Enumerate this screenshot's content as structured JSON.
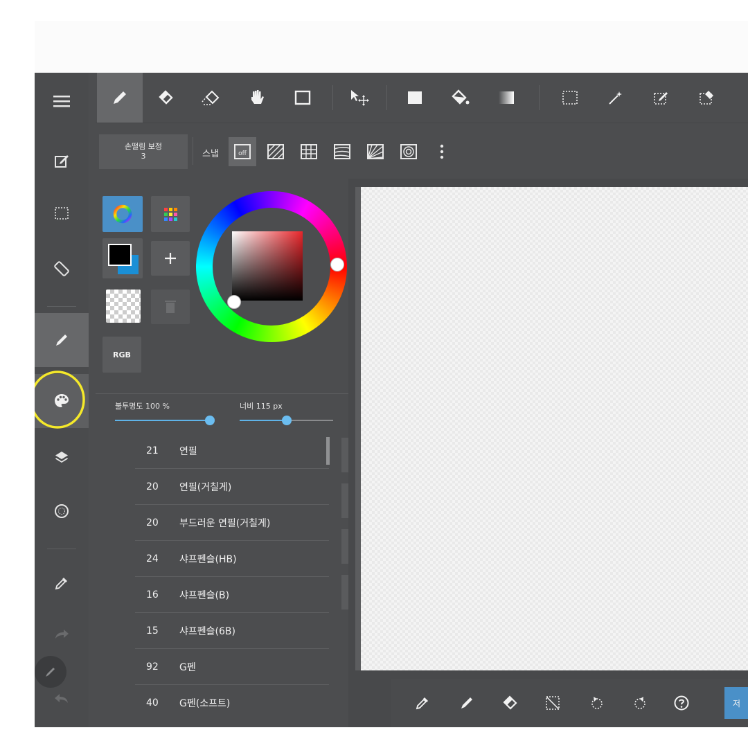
{
  "stabilizer": {
    "label": "손떨림 보정",
    "value": "3"
  },
  "snap": {
    "label": "스냅",
    "off_label": "off"
  },
  "color_panel": {
    "rgb_label": "RGB",
    "colors": {
      "primary": "#000000",
      "secondary": "#1a8fd6"
    }
  },
  "sliders": {
    "opacity": {
      "label": "불투명도 100 %",
      "value": 100
    },
    "width": {
      "label": "너비 115 px",
      "value": 115
    }
  },
  "brushes": [
    {
      "size": "21",
      "name": "연필"
    },
    {
      "size": "20",
      "name": "연필(거칠게)"
    },
    {
      "size": "20",
      "name": "부드러운 연필(거칠게)"
    },
    {
      "size": "24",
      "name": "샤프펜슬(HB)"
    },
    {
      "size": "16",
      "name": "샤프펜슬(B)"
    },
    {
      "size": "15",
      "name": "샤프펜슬(6B)"
    },
    {
      "size": "92",
      "name": "G펜"
    },
    {
      "size": "40",
      "name": "G펜(소프트)"
    }
  ],
  "bottom": {
    "next_label": "저"
  },
  "accent": "#4a90c8",
  "highlight": "#f5e92a"
}
